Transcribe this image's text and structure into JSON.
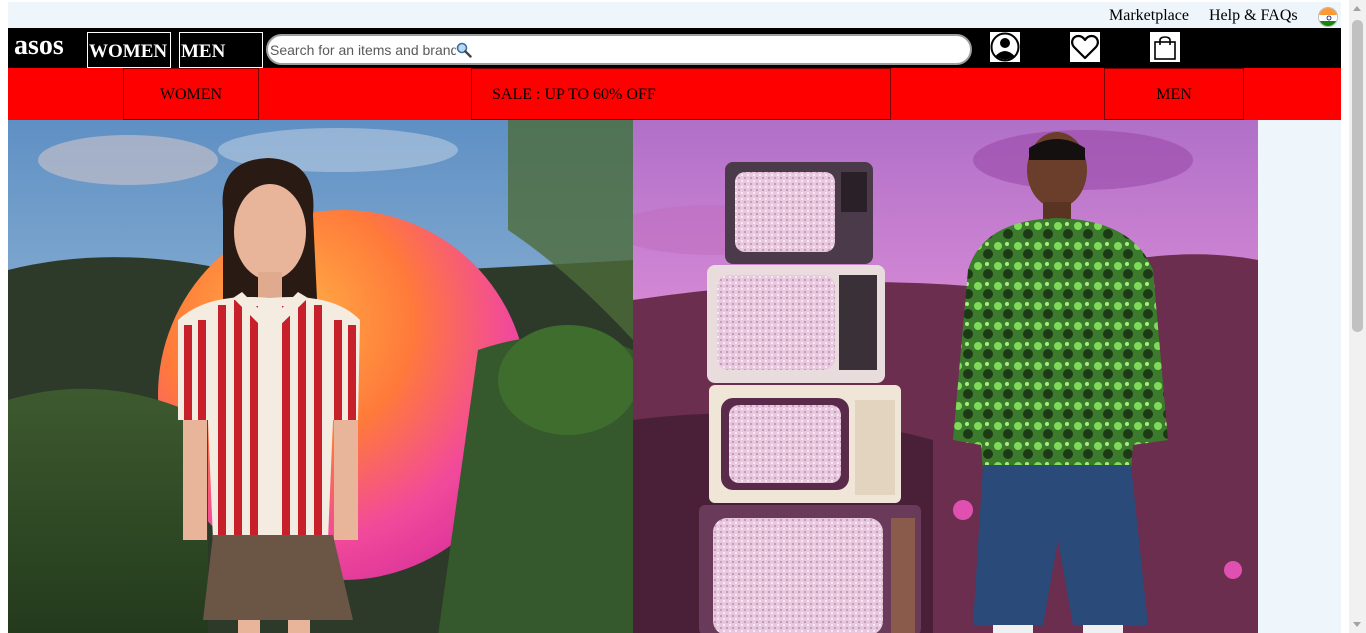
{
  "util_bar": {
    "marketplace": "Marketplace",
    "help": "Help & FAQs",
    "flag_icon": "india-flag-icon"
  },
  "header": {
    "logo": "asos",
    "women_button": "WOMEN",
    "men_button": "MEN",
    "search_placeholder": "Search for an items and brands",
    "search_icon": "search-icon",
    "icons": [
      "account-icon",
      "heart-icon",
      "shopping-bag-icon"
    ]
  },
  "nav": {
    "women": "WOMEN",
    "sale": "SALE : UP TO 60% OFF",
    "men": "MEN"
  },
  "hero": {
    "left_image": "woman-striped-top-pink-orange-sphere",
    "right_image": "man-green-jacket-stacked-tvs"
  },
  "colors": {
    "header_bg": "#000000",
    "nav_bg": "#ff0000",
    "page_bg": "#eef5fb"
  }
}
